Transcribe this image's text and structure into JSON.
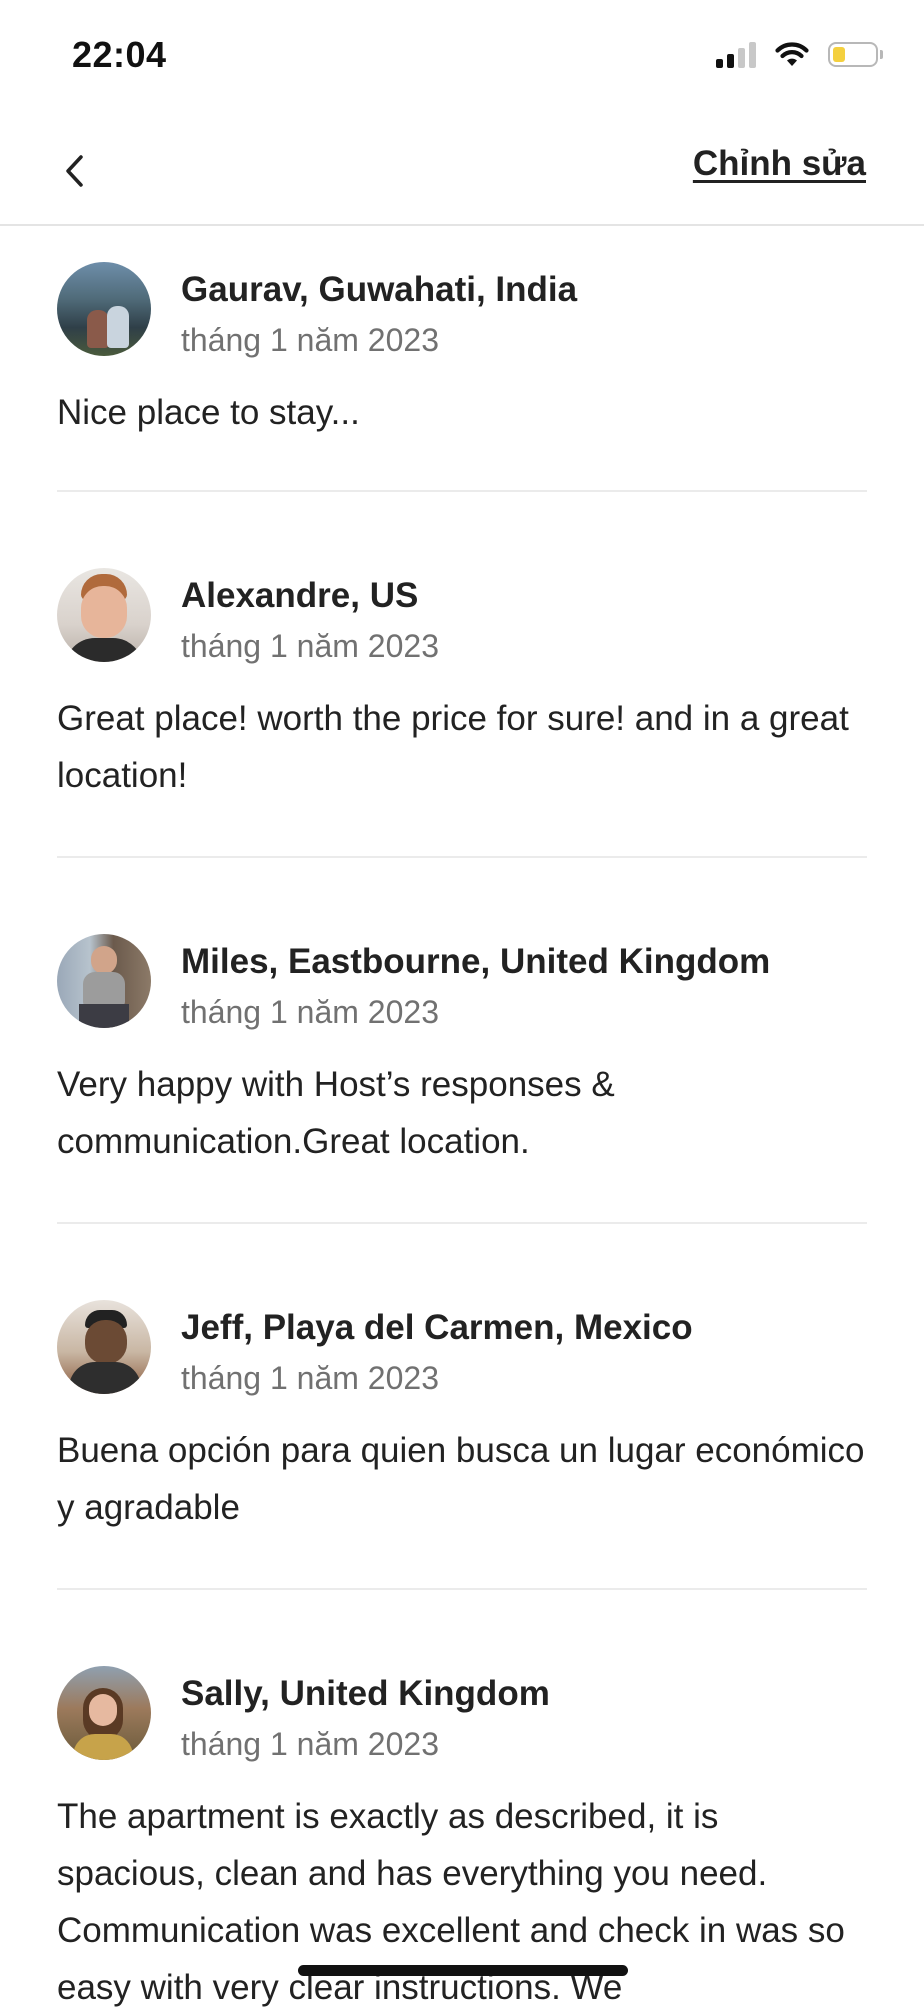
{
  "status_bar": {
    "time": "22:04",
    "signal_icon": "cellular-signal-icon",
    "wifi_icon": "wifi-icon",
    "battery_icon": "battery-low-icon",
    "battery_level": 0.3,
    "battery_color": "#f4d03f"
  },
  "nav": {
    "back_icon": "chevron-left-icon",
    "edit_label": "Chỉnh sửa"
  },
  "reviews": [
    {
      "name": "Gaurav, Guwahati, India",
      "date": "tháng 1 năm 2023",
      "text": "Nice place to stay..."
    },
    {
      "name": "Alexandre, US",
      "date": "tháng 1 năm 2023",
      "text": "Great place! worth the price for sure! and in a great location!"
    },
    {
      "name": "Miles, Eastbourne, United Kingdom",
      "date": "tháng 1 năm 2023",
      "text": "Very happy with Host’s responses & communication.Great location."
    },
    {
      "name": "Jeff, Playa del Carmen, Mexico",
      "date": "tháng 1 năm 2023",
      "text": "Buena opción para quien busca un lugar económico y agradable"
    },
    {
      "name": "Sally, United Kingdom",
      "date": "tháng 1 năm 2023",
      "text": "The apartment is exactly as described, it is spacious, clean and has everything you need. Communication was excellent and check in was so easy with very clear instructions. We"
    }
  ],
  "colors": {
    "text_primary": "#222222",
    "text_secondary": "#717171",
    "divider": "#ebebeb"
  }
}
